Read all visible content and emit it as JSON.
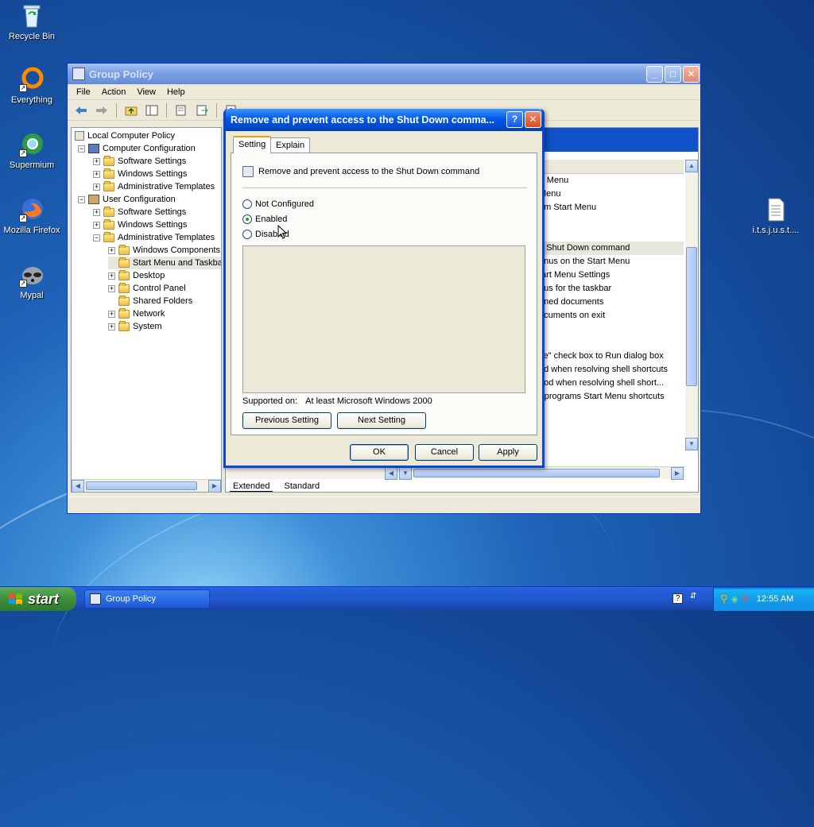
{
  "desktop": {
    "icons": [
      {
        "label": "Recycle Bin"
      },
      {
        "label": "Everything"
      },
      {
        "label": "Supermium"
      },
      {
        "label": "Mozilla Firefox"
      },
      {
        "label": "Mypal"
      },
      {
        "label": "i.t.s.j.u.s.t...."
      }
    ]
  },
  "gp_window": {
    "title": "Group Policy",
    "menu": [
      "File",
      "Action",
      "View",
      "Help"
    ],
    "tree": [
      "Local Computer Policy",
      "Computer Configuration",
      "Software Settings",
      "Windows Settings",
      "Administrative Templates",
      "User Configuration",
      "Software Settings",
      "Windows Settings",
      "Administrative Templates",
      "Windows Components",
      "Start Menu and Taskba",
      "Desktop",
      "Control Panel",
      "Shared Folders",
      "Network",
      "System"
    ],
    "right_items": [
      "rt Menu",
      "Menu",
      "om Start Menu",
      "e Shut Down command",
      "enus on the Start Menu",
      "tart Menu Settings",
      "nus for the taskbar",
      "ened documents",
      "ocuments on exit",
      "ce\" check box to Run dialog box",
      "od when resolving shell shortcuts",
      "hod when resolving shell short...",
      "r programs Start Menu shortcuts"
    ],
    "tabs": [
      "Extended",
      "Standard"
    ]
  },
  "dialog": {
    "title": "Remove and prevent access to the Shut Down comma...",
    "tabs": [
      "Setting",
      "Explain"
    ],
    "policy_name": "Remove and prevent access to the Shut Down command",
    "options": [
      "Not Configured",
      "Enabled",
      "Disabled"
    ],
    "selected_option": "Enabled",
    "supported_label": "Supported on:",
    "supported_value": "At least Microsoft Windows 2000",
    "prev_button": "Previous Setting",
    "next_button": "Next Setting",
    "ok": "OK",
    "cancel": "Cancel",
    "apply": "Apply"
  },
  "taskbar": {
    "start": "start",
    "task": "Group Policy",
    "clock": "12:55 AM"
  }
}
